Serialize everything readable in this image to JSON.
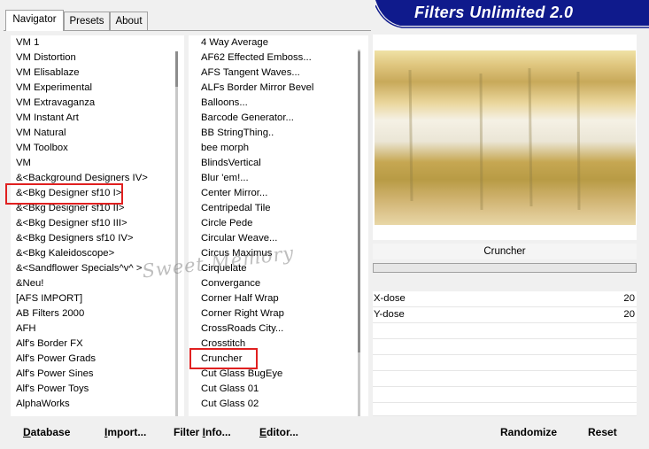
{
  "tabs": [
    "Navigator",
    "Presets",
    "About"
  ],
  "brand_title": "Filters Unlimited 2.0",
  "categories": [
    "VM 1",
    "VM Distortion",
    "VM Elisablaze",
    "VM Experimental",
    "VM Extravaganza",
    "VM Instant Art",
    "VM Natural",
    "VM Toolbox",
    "VM",
    "&<Background Designers IV>",
    "&<Bkg Designer sf10 I>",
    "&<Bkg Designer sf10 II>",
    "&<Bkg Designer sf10 III>",
    "&<Bkg Designers sf10 IV>",
    "&<Bkg Kaleidoscope>",
    "&<Sandflower Specials^v^ >",
    "&Neu!",
    "[AFS IMPORT]",
    "AB Filters 2000",
    "AFH",
    "Alf's Border FX",
    "Alf's Power Grads",
    "Alf's Power Sines",
    "Alf's Power Toys",
    "AlphaWorks"
  ],
  "filters": [
    "4 Way Average",
    "AF62 Effected Emboss...",
    "AFS Tangent Waves...",
    "ALFs Border Mirror Bevel",
    "Balloons...",
    "Barcode Generator...",
    "BB StringThing..",
    "bee morph",
    "BlindsVertical",
    "Blur 'em!...",
    "Center Mirror...",
    "Centripedal Tile",
    "Circle Pede",
    "Circular Weave...",
    "Circus Maximus",
    "Cirquelate",
    "Convergance",
    "Corner Half Wrap",
    "Corner Right Wrap",
    "CrossRoads City...",
    "Crosstitch",
    "Cruncher",
    "Cut Glass  BugEye",
    "Cut Glass 01",
    "Cut Glass 02"
  ],
  "selected_filter_name": "Cruncher",
  "params": [
    {
      "label": "X-dose",
      "value": "20"
    },
    {
      "label": "Y-dose",
      "value": "20"
    }
  ],
  "watermark": "Sweet Memory",
  "bottom_buttons": {
    "database": {
      "u": "D",
      "rest": "atabase"
    },
    "import": {
      "u": "I",
      "rest": "mport..."
    },
    "filter_info": {
      "pre": "Filter ",
      "u": "I",
      "rest": "nfo..."
    },
    "editor": {
      "u": "E",
      "rest": "ditor..."
    },
    "randomize": "Randomize",
    "reset": "Reset"
  },
  "colors": {
    "highlight_box": "#e02020",
    "brand_bg": "#0f1a8c",
    "preview_gold": "#c8a95a"
  }
}
